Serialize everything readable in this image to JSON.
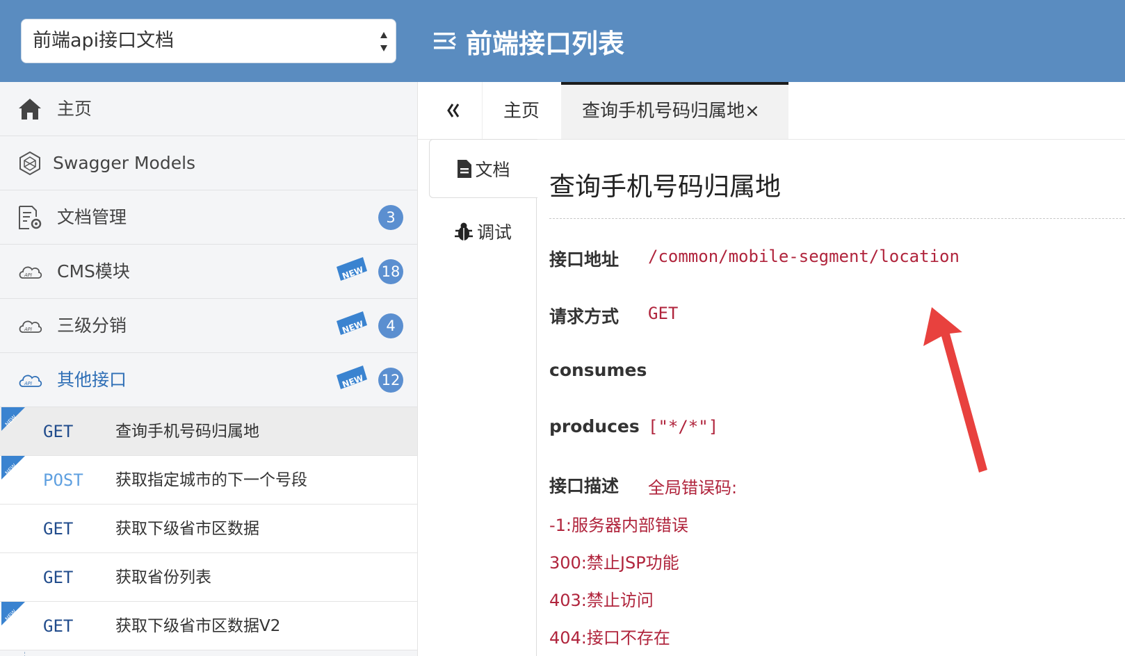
{
  "header": {
    "doc_select_value": "前端api接口文档",
    "page_title": "前端接口列表",
    "background_color": "#5a8cc0"
  },
  "sidebar": {
    "items": [
      {
        "label": "主页",
        "icon": "home-icon"
      },
      {
        "label": "Swagger Models",
        "icon": "swagger-models-icon"
      },
      {
        "label": "文档管理",
        "icon": "document-settings-icon",
        "count": "3"
      },
      {
        "label": "CMS模块",
        "icon": "cloud-api-icon",
        "count": "18",
        "new": "NEW"
      },
      {
        "label": "三级分销",
        "icon": "cloud-api-icon",
        "count": "4",
        "new": "NEW"
      },
      {
        "label": "其他接口",
        "icon": "cloud-api-icon",
        "count": "12",
        "new": "NEW",
        "active": true
      }
    ],
    "endpoints": [
      {
        "method": "GET",
        "label": "查询手机号码归属地",
        "new": true,
        "selected": true
      },
      {
        "method": "POST",
        "label": "获取指定城市的下一个号段",
        "new": true
      },
      {
        "method": "GET",
        "label": "获取下级省市区数据"
      },
      {
        "method": "GET",
        "label": "获取省份列表"
      },
      {
        "method": "GET",
        "label": "获取下级省市区数据V2",
        "new": true
      }
    ]
  },
  "tabs": {
    "home": "主页",
    "active": "查询手机号码归属地×"
  },
  "side_tabs": {
    "doc": "文档",
    "debug": "调试"
  },
  "content": {
    "title": "查询手机号码归属地",
    "address_label": "接口地址",
    "address_value": "/common/mobile-segment/location",
    "method_label": "请求方式",
    "method_value": "GET",
    "consumes_label": "consumes",
    "produces_label": "produces",
    "produces_value": "[\"*/*\"]",
    "desc_label": "接口描述",
    "desc_value": "全局错误码:",
    "error_codes": [
      "-1:服务器内部错误",
      "300:禁止JSP功能",
      "403:禁止访问",
      "404:接口不存在"
    ]
  },
  "colors": {
    "accent": "#5a8cc0",
    "badge": "#5b8fd0",
    "code_red": "#b0243c",
    "arrow_red": "#e8413e"
  }
}
